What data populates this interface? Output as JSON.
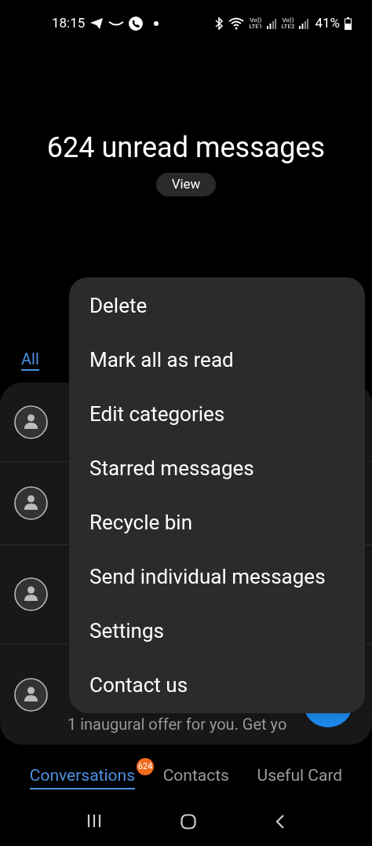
{
  "status_bar": {
    "time": "18:15",
    "sims": [
      {
        "volte": "Vo))",
        "network": "LTE1"
      },
      {
        "volte": "Vo))",
        "network": "LTE2"
      }
    ],
    "battery": "41%"
  },
  "header": {
    "title": "624 unread messages",
    "button": "View"
  },
  "filter_tabs": [
    {
      "label": "All",
      "selected": true
    }
  ],
  "conversations": [
    {
      "kind": "covered"
    },
    {
      "kind": "covered"
    },
    {
      "kind": "covered"
    },
    {
      "kind": "preview",
      "preview": "1 inaugural offer for you. Get yo"
    }
  ],
  "menu": {
    "items": [
      "Delete",
      "Mark all as read",
      "Edit categories",
      "Starred messages",
      "Recycle bin",
      "Send individual messages",
      "Settings",
      "Contact us"
    ]
  },
  "bottom_tabs": [
    {
      "label": "Conversations",
      "selected": true,
      "badge": "624"
    },
    {
      "label": "Contacts",
      "selected": false
    },
    {
      "label": "Useful Card",
      "selected": false
    }
  ]
}
